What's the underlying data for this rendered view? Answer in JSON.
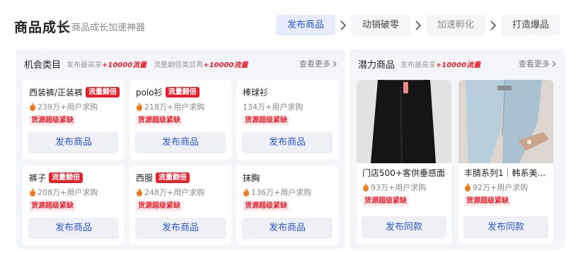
{
  "header": {
    "title": "商品成长",
    "subtitle": "商品成长加速神器",
    "steps": [
      {
        "label": "发布商品",
        "state": "active"
      },
      {
        "label": "动销破零",
        "state": "normal"
      },
      {
        "label": "加速孵化",
        "state": "muted"
      },
      {
        "label": "打造爆品",
        "state": "normal"
      }
    ]
  },
  "opportunity": {
    "title": "机会类目",
    "note1": "发布最高享",
    "boost1": "+10000流量",
    "note2": "流量翻倍类目再",
    "boost2": "+10000流量",
    "more": "查看更多",
    "cards": [
      {
        "name": "西装裤/正装裤",
        "tag": "流量翻倍",
        "demand": "239万+用户求购",
        "shortage": "货源超级紧缺",
        "button": "发布商品"
      },
      {
        "name": "polo衫",
        "tag": "流量翻倍",
        "demand": "218万+用户求购",
        "shortage": "货源超级紧缺",
        "button": "发布商品"
      },
      {
        "name": "棒球衫",
        "tag": "",
        "demand": "134万+用户求购",
        "shortage": "货源超级紧缺",
        "button": "发布商品"
      },
      {
        "name": "裤子",
        "tag": "流量翻倍",
        "demand": "208万+用户求购",
        "shortage": "货源超级紧缺",
        "button": "发布商品"
      },
      {
        "name": "西服",
        "tag": "流量翻倍",
        "demand": "248万+用户求购",
        "shortage": "货源超级紧缺",
        "button": "发布商品"
      },
      {
        "name": "抹胸",
        "tag": "",
        "demand": "136万+用户求购",
        "shortage": "货源超级紧缺",
        "button": "发布商品"
      }
    ]
  },
  "potential": {
    "title": "潜力商品",
    "note": "发布最高享",
    "boost": "+10000流量",
    "more": "查看更多",
    "products": [
      {
        "name": "门店500+客供垂感面...",
        "demand": "93万+用户求购",
        "shortage": "货源超级紧缺",
        "button": "发布同款",
        "image": "black-wide-leg-trousers"
      },
      {
        "name": "丰腈系列1｜韩系美...",
        "demand": "92万+用户求购",
        "shortage": "货源超级紧缺",
        "button": "发布同款",
        "image": "light-blue-jeans-with-sandals"
      }
    ]
  },
  "colors": {
    "accent": "#2f57d9",
    "active_step_bg": "#e7ecfd",
    "tag_red": "#e8202c",
    "panel_bg": "#f4f5f8",
    "fire": "#f07b1f"
  }
}
